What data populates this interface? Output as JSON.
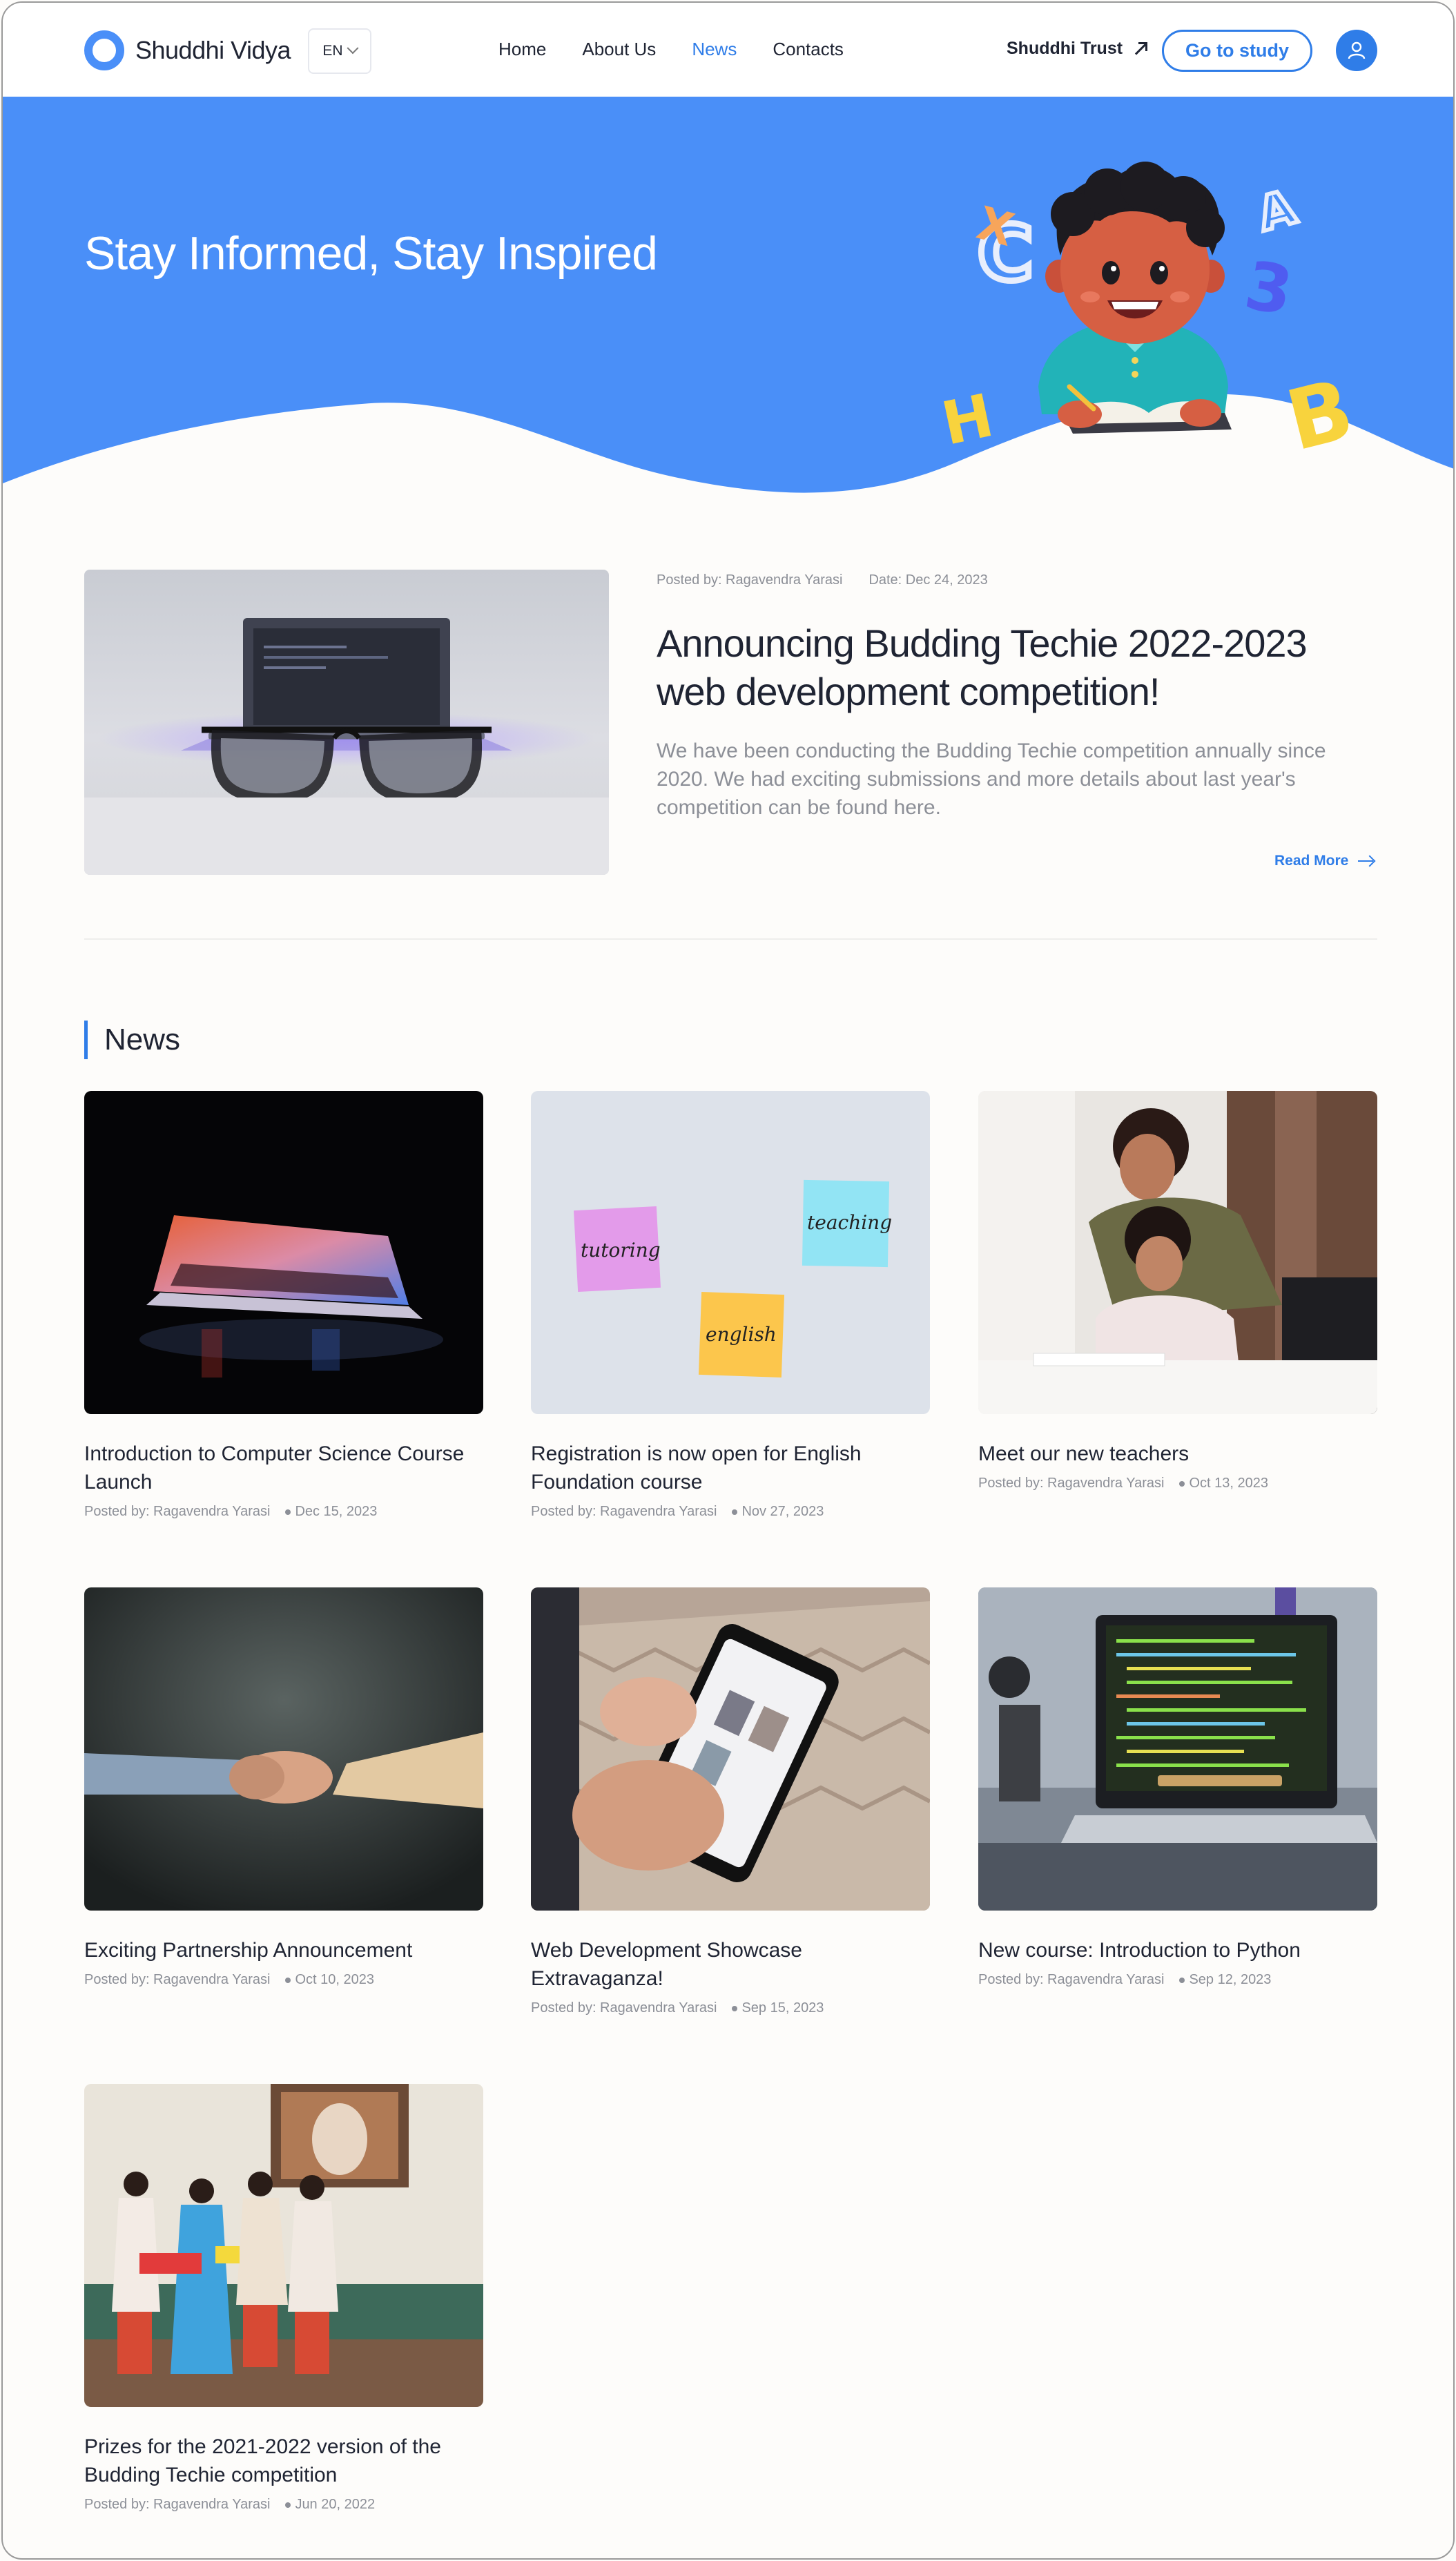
{
  "brand": {
    "name": "Shuddhi Vidya",
    "accent": "#2f7de8",
    "hero_bg": "#4a8ff8"
  },
  "header": {
    "lang": "EN",
    "nav": [
      {
        "label": "Home",
        "active": false
      },
      {
        "label": "About Us",
        "active": false
      },
      {
        "label": "News",
        "active": true
      },
      {
        "label": "Contacts",
        "active": false
      }
    ],
    "trust_link": "Shuddhi Trust",
    "cta": "Go to study"
  },
  "hero": {
    "title": "Stay Informed, Stay Inspired"
  },
  "featured": {
    "posted_by": "Posted by: Ragavendra Yarasi",
    "date": "Date: Dec 24, 2023",
    "title": "Announcing Budding Techie 2022-2023 web development competition!",
    "description": "We have been conducting the Budding Techie competition annually since 2020. We had exciting submissions and more details about last year's competition can be found here.",
    "read_more": "Read More"
  },
  "news": {
    "heading": "News",
    "items": [
      {
        "title": "Introduction to Computer Science Course Launch",
        "posted_by": "Posted by: Ragavendra Yarasi",
        "date": "Dec 15, 2023"
      },
      {
        "title": "Registration is now open for English Foundation course",
        "posted_by": "Posted by: Ragavendra Yarasi",
        "date": "Nov 27, 2023"
      },
      {
        "title": "Meet our new teachers",
        "posted_by": "Posted by: Ragavendra Yarasi",
        "date": "Oct 13, 2023"
      },
      {
        "title": "Exciting Partnership Announcement",
        "posted_by": "Posted by: Ragavendra Yarasi",
        "date": "Oct 10, 2023"
      },
      {
        "title": "Web Development Showcase Extravaganza!",
        "posted_by": "Posted by: Ragavendra Yarasi",
        "date": "Sep 15, 2023"
      },
      {
        "title": "New course: Introduction to Python",
        "posted_by": "Posted by: Ragavendra Yarasi",
        "date": "Sep 12, 2023"
      },
      {
        "title": "Prizes for the 2021-2022 version of the Budding Techie competition",
        "posted_by": "Posted by: Ragavendra Yarasi",
        "date": "Jun 20, 2022"
      }
    ]
  },
  "sticky_notes": {
    "note1": "tutoring",
    "note2": "english",
    "note3": "teaching"
  }
}
